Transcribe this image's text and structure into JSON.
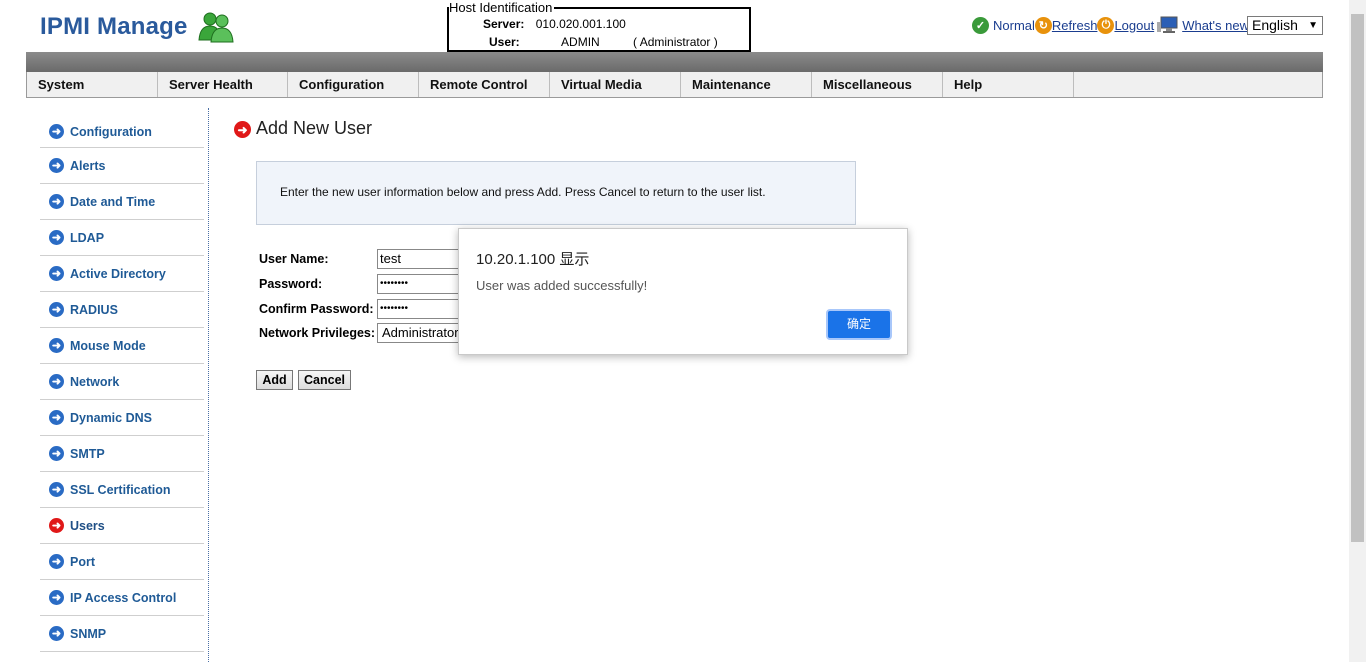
{
  "header": {
    "logo_text": "IPMI Manage",
    "host_id": {
      "legend": "Host Identification",
      "server_label": "Server:",
      "server_value": "010.020.001.100",
      "user_label": "User:",
      "user_value": "ADMIN",
      "user_role": "( Administrator )"
    },
    "status": "Normal",
    "refresh": "Refresh",
    "logout": "Logout",
    "whats_new": "What's  new",
    "language": "English"
  },
  "menu": [
    "System",
    "Server Health",
    "Configuration",
    "Remote Control",
    "Virtual Media",
    "Maintenance",
    "Miscellaneous",
    "Help"
  ],
  "sidebar": [
    "Configuration",
    "Alerts",
    "Date and Time",
    "LDAP",
    "Active Directory",
    "RADIUS",
    "Mouse Mode",
    "Network",
    "Dynamic DNS",
    "SMTP",
    "SSL Certification",
    "Users",
    "Port",
    "IP Access Control",
    "SNMP"
  ],
  "sidebar_active": "Users",
  "main": {
    "title": "Add New User",
    "info": "Enter the new user information below and press Add. Press Cancel to return to the user list.",
    "form": {
      "username_label": "User Name:",
      "username_value": "test",
      "password_label": "Password:",
      "password_value": "••••••••",
      "confirm_label": "Confirm Password:",
      "confirm_value": "••••••••",
      "privileges_label": "Network Privileges:",
      "privileges_value": "Administrator"
    },
    "add_label": "Add",
    "cancel_label": "Cancel"
  },
  "dialog": {
    "title": "10.20.1.100 显示",
    "message": "User was added successfully!",
    "ok_label": "确定"
  },
  "colors": {
    "accent": "#1a73e8",
    "active": "#e01818",
    "link": "#1a3d8f"
  }
}
